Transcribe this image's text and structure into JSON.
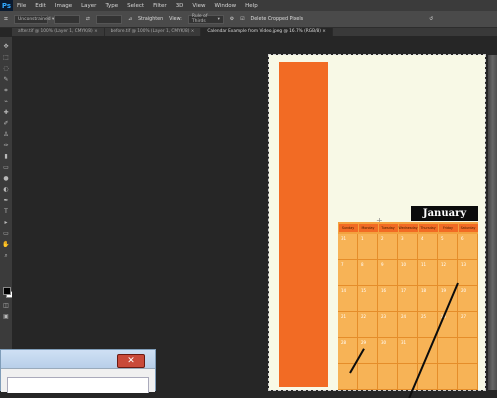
{
  "menubar": {
    "logo": "Ps",
    "items": [
      "File",
      "Edit",
      "Image",
      "Layer",
      "Type",
      "Select",
      "Filter",
      "3D",
      "View",
      "Window",
      "Help"
    ]
  },
  "options": {
    "tool_icon": "crop-icon",
    "ratio": "Unconstrained",
    "straighten": "Straighten",
    "view_label": "View:",
    "view_value": "Rule of Thirds",
    "delete_label": "Delete Cropped Pixels",
    "delete_checked": true
  },
  "tabs": [
    "after.tif @ 100% (Layer 1, CMYK/8)",
    "before.tif @ 100% (Layer 1, CMYK/8)",
    "Calendar Example from Video.jpeg @ 16.7% (RGB/8)"
  ],
  "calendar": {
    "month": "January",
    "days": [
      "Sunday",
      "Monday",
      "Tuesday",
      "Wednesday",
      "Thursday",
      "Friday",
      "Saturday"
    ],
    "weeks": [
      [
        "31",
        "1",
        "2",
        "3",
        "4",
        "5",
        "6"
      ],
      [
        "7",
        "8",
        "9",
        "10",
        "11",
        "12",
        "13"
      ],
      [
        "14",
        "15",
        "16",
        "17",
        "18",
        "19",
        "20"
      ],
      [
        "21",
        "22",
        "23",
        "24",
        "25",
        "26",
        "27"
      ],
      [
        "28",
        "29",
        "30",
        "31",
        "",
        "",
        ""
      ],
      [
        "",
        "",
        "",
        "",
        "",
        "",
        ""
      ]
    ]
  },
  "colors": {
    "accent_orange": "#f26b24",
    "cell_orange": "#f7b356",
    "paper": "#f8f9e6"
  },
  "dialog": {
    "close_label": "✕"
  }
}
